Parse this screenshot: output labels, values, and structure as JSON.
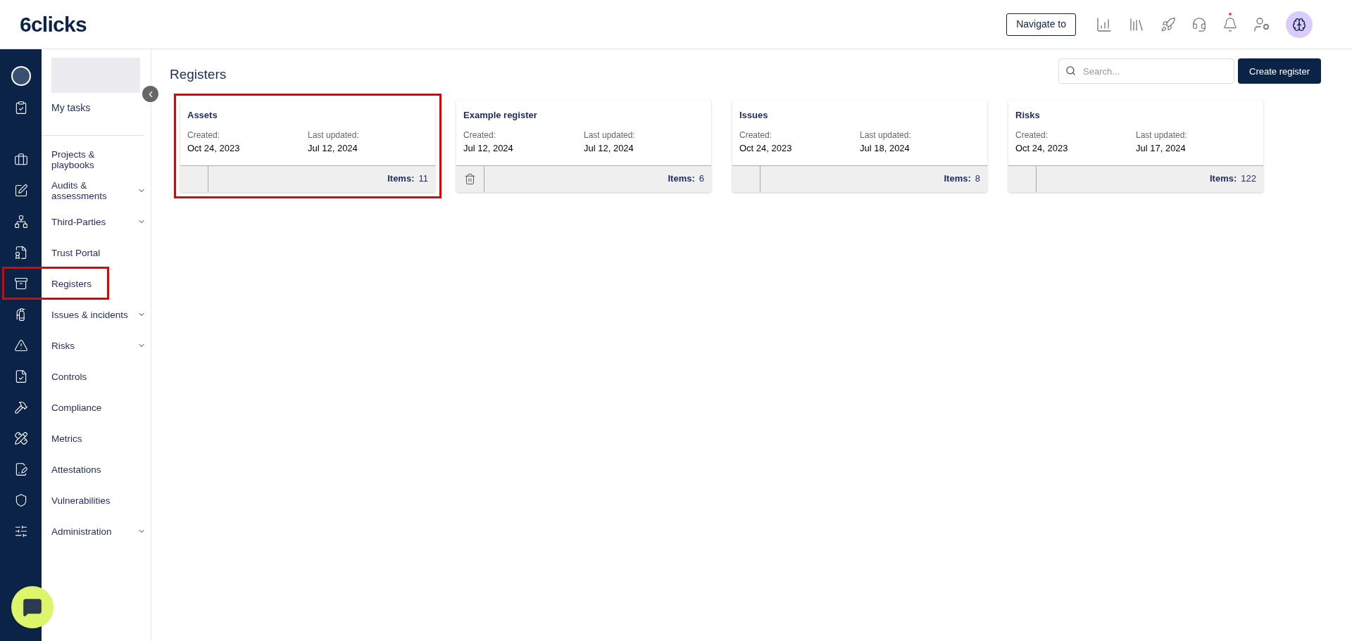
{
  "header": {
    "logo": "6clicks",
    "navigate_button": "Navigate to",
    "notifications": {
      "unread": true
    }
  },
  "sidebar": {
    "top_item": {
      "label": "My tasks"
    },
    "items": [
      {
        "label": "Projects & playbooks",
        "expandable": false,
        "highlighted": false
      },
      {
        "label": "Audits & assessments",
        "expandable": true,
        "highlighted": false
      },
      {
        "label": "Third-Parties",
        "expandable": true,
        "highlighted": false
      },
      {
        "label": "Trust Portal",
        "expandable": false,
        "highlighted": false
      },
      {
        "label": "Registers",
        "expandable": false,
        "highlighted": true
      },
      {
        "label": "Issues & incidents",
        "expandable": true,
        "highlighted": false
      },
      {
        "label": "Risks",
        "expandable": true,
        "highlighted": false
      },
      {
        "label": "Controls",
        "expandable": false,
        "highlighted": false
      },
      {
        "label": "Compliance",
        "expandable": false,
        "highlighted": false
      },
      {
        "label": "Metrics",
        "expandable": false,
        "highlighted": false
      },
      {
        "label": "Attestations",
        "expandable": false,
        "highlighted": false
      },
      {
        "label": "Vulnerabilities",
        "expandable": false,
        "highlighted": false
      },
      {
        "label": "Administration",
        "expandable": true,
        "highlighted": false
      }
    ]
  },
  "page": {
    "title": "Registers",
    "search": {
      "placeholder": "Search..."
    },
    "create_button": "Create register"
  },
  "registers": [
    {
      "name": "Assets",
      "created_label": "Created:",
      "created": "Oct 24, 2023",
      "updated_label": "Last updated:",
      "updated": "Jul 12, 2024",
      "items_label": "Items:",
      "items": "11",
      "deletable": false,
      "highlighted": true
    },
    {
      "name": "Example register",
      "created_label": "Created:",
      "created": "Jul 12, 2024",
      "updated_label": "Last updated:",
      "updated": "Jul 12, 2024",
      "items_label": "Items:",
      "items": "6",
      "deletable": true,
      "highlighted": false
    },
    {
      "name": "Issues",
      "created_label": "Created:",
      "created": "Oct 24, 2023",
      "updated_label": "Last updated:",
      "updated": "Jul 18, 2024",
      "items_label": "Items:",
      "items": "8",
      "deletable": false,
      "highlighted": false
    },
    {
      "name": "Risks",
      "created_label": "Created:",
      "created": "Oct 24, 2023",
      "updated_label": "Last updated:",
      "updated": "Jul 17, 2024",
      "items_label": "Items:",
      "items": "122",
      "deletable": false,
      "highlighted": false
    }
  ]
}
